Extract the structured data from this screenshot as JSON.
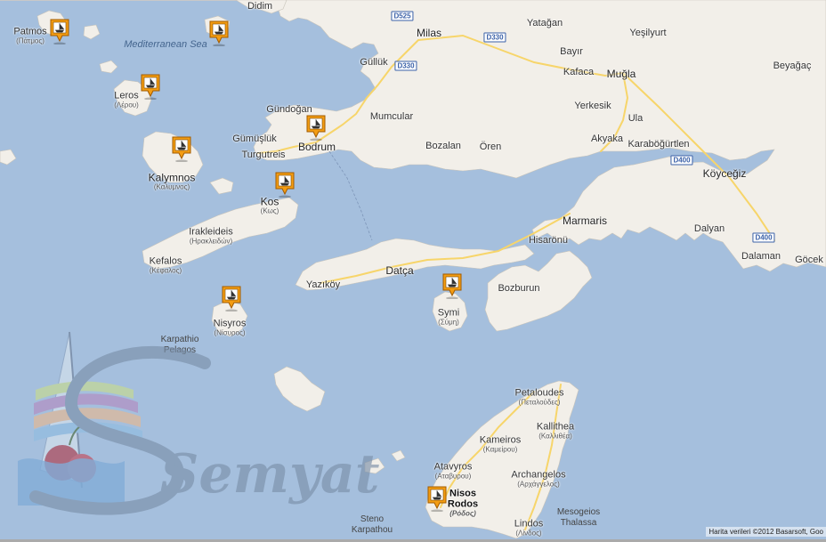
{
  "map": {
    "water_labels": [
      {
        "id": "mediterranean",
        "text": "Mediterranean Sea"
      },
      {
        "id": "karpathio",
        "text": "Karpathio Pelagos"
      },
      {
        "id": "steno",
        "text": "Steno Karpathou"
      },
      {
        "id": "mesogeios",
        "text": "Mesogeios Thalassa"
      }
    ],
    "places": [
      {
        "id": "patmos",
        "name": "Patmos",
        "greek": "(Πάτμος)"
      },
      {
        "id": "didim",
        "name": "Didim",
        "greek": ""
      },
      {
        "id": "milas",
        "name": "Milas",
        "greek": ""
      },
      {
        "id": "yatagan",
        "name": "Yatağan",
        "greek": ""
      },
      {
        "id": "yesilyurt",
        "name": "Yeşilyurt",
        "greek": ""
      },
      {
        "id": "bayir",
        "name": "Bayır",
        "greek": ""
      },
      {
        "id": "gulluk",
        "name": "Güllük",
        "greek": ""
      },
      {
        "id": "kafaca",
        "name": "Kafaca",
        "greek": ""
      },
      {
        "id": "mugla",
        "name": "Muğla",
        "greek": ""
      },
      {
        "id": "beyagac",
        "name": "Beyağaç",
        "greek": ""
      },
      {
        "id": "leros",
        "name": "Leros",
        "greek": "(Λέρου)"
      },
      {
        "id": "gundogan",
        "name": "Gündoğan",
        "greek": ""
      },
      {
        "id": "mumcular",
        "name": "Mumcular",
        "greek": ""
      },
      {
        "id": "yerkesik",
        "name": "Yerkesik",
        "greek": ""
      },
      {
        "id": "ula",
        "name": "Ula",
        "greek": ""
      },
      {
        "id": "gumusluk",
        "name": "Gümüşlük",
        "greek": ""
      },
      {
        "id": "bodrum",
        "name": "Bodrum",
        "greek": ""
      },
      {
        "id": "bozalan",
        "name": "Bozalan",
        "greek": ""
      },
      {
        "id": "oren",
        "name": "Ören",
        "greek": ""
      },
      {
        "id": "akyaka",
        "name": "Akyaka",
        "greek": ""
      },
      {
        "id": "karabogurtlen",
        "name": "Karaböğürtlen",
        "greek": ""
      },
      {
        "id": "turgutreis",
        "name": "Turgutreis",
        "greek": ""
      },
      {
        "id": "koycegiz",
        "name": "Köyceğiz",
        "greek": ""
      },
      {
        "id": "kalymnos",
        "name": "Kalymnos",
        "greek": "(Καλυμνος)"
      },
      {
        "id": "kos",
        "name": "Kos",
        "greek": "(Κως)"
      },
      {
        "id": "marmaris",
        "name": "Marmaris",
        "greek": ""
      },
      {
        "id": "dalyan",
        "name": "Dalyan",
        "greek": ""
      },
      {
        "id": "irakleideis",
        "name": "Irakleideis",
        "greek": "(Ηρακλειδών)"
      },
      {
        "id": "hisaronu",
        "name": "Hisarönü",
        "greek": ""
      },
      {
        "id": "dalaman",
        "name": "Dalaman",
        "greek": ""
      },
      {
        "id": "gocek",
        "name": "Göcek",
        "greek": ""
      },
      {
        "id": "kefalos",
        "name": "Kefalos",
        "greek": "(Κέφαλος)"
      },
      {
        "id": "datca",
        "name": "Datça",
        "greek": ""
      },
      {
        "id": "yazikoy",
        "name": "Yazıköy",
        "greek": ""
      },
      {
        "id": "bozburun",
        "name": "Bozburun",
        "greek": ""
      },
      {
        "id": "nisyros",
        "name": "Nisyros",
        "greek": "(Νίσυρος)"
      },
      {
        "id": "symi",
        "name": "Symi",
        "greek": "(Σύμη)"
      },
      {
        "id": "petaloudes",
        "name": "Petaloudes",
        "greek": "(Πεταλούδες)"
      },
      {
        "id": "kallithea",
        "name": "Kallithea",
        "greek": "(Καλλιθέα)"
      },
      {
        "id": "kameiros",
        "name": "Kameiros",
        "greek": "(Καμείρου)"
      },
      {
        "id": "atavyros",
        "name": "Atavyros",
        "greek": "(Αταβυρου)"
      },
      {
        "id": "archangelos",
        "name": "Archangelos",
        "greek": "(Αρχάγγελος)"
      },
      {
        "id": "rodos",
        "name": "Nisos Rodos",
        "greek": "(Ρόδος)"
      },
      {
        "id": "lindos",
        "name": "Lindos",
        "greek": "(Λίνδος)"
      }
    ],
    "road_shields": [
      {
        "id": "d525",
        "text": "D525"
      },
      {
        "id": "d330a",
        "text": "D330"
      },
      {
        "id": "d330b",
        "text": "D330"
      },
      {
        "id": "d400a",
        "text": "D400"
      },
      {
        "id": "d400b",
        "text": "D400"
      }
    ],
    "markers": [
      {
        "id": "patmos",
        "icon": "yacht-icon"
      },
      {
        "id": "agathonisi",
        "icon": "yacht-icon"
      },
      {
        "id": "leros",
        "icon": "yacht-icon"
      },
      {
        "id": "kalymnos",
        "icon": "yacht-icon"
      },
      {
        "id": "bodrum",
        "icon": "yacht-icon"
      },
      {
        "id": "kos",
        "icon": "yacht-icon"
      },
      {
        "id": "nisyros",
        "icon": "yacht-icon"
      },
      {
        "id": "symi",
        "icon": "yacht-icon"
      },
      {
        "id": "rodos",
        "icon": "yacht-icon"
      }
    ],
    "marker_color": "#f39c12",
    "land_color": "#f2efe9",
    "water_color": "#a5bfdd",
    "road_color": "#f7d56a"
  },
  "watermark": {
    "text": "Semyat"
  },
  "attribution": {
    "text": "Harita verileri ©2012 Basarsoft, Goo"
  }
}
